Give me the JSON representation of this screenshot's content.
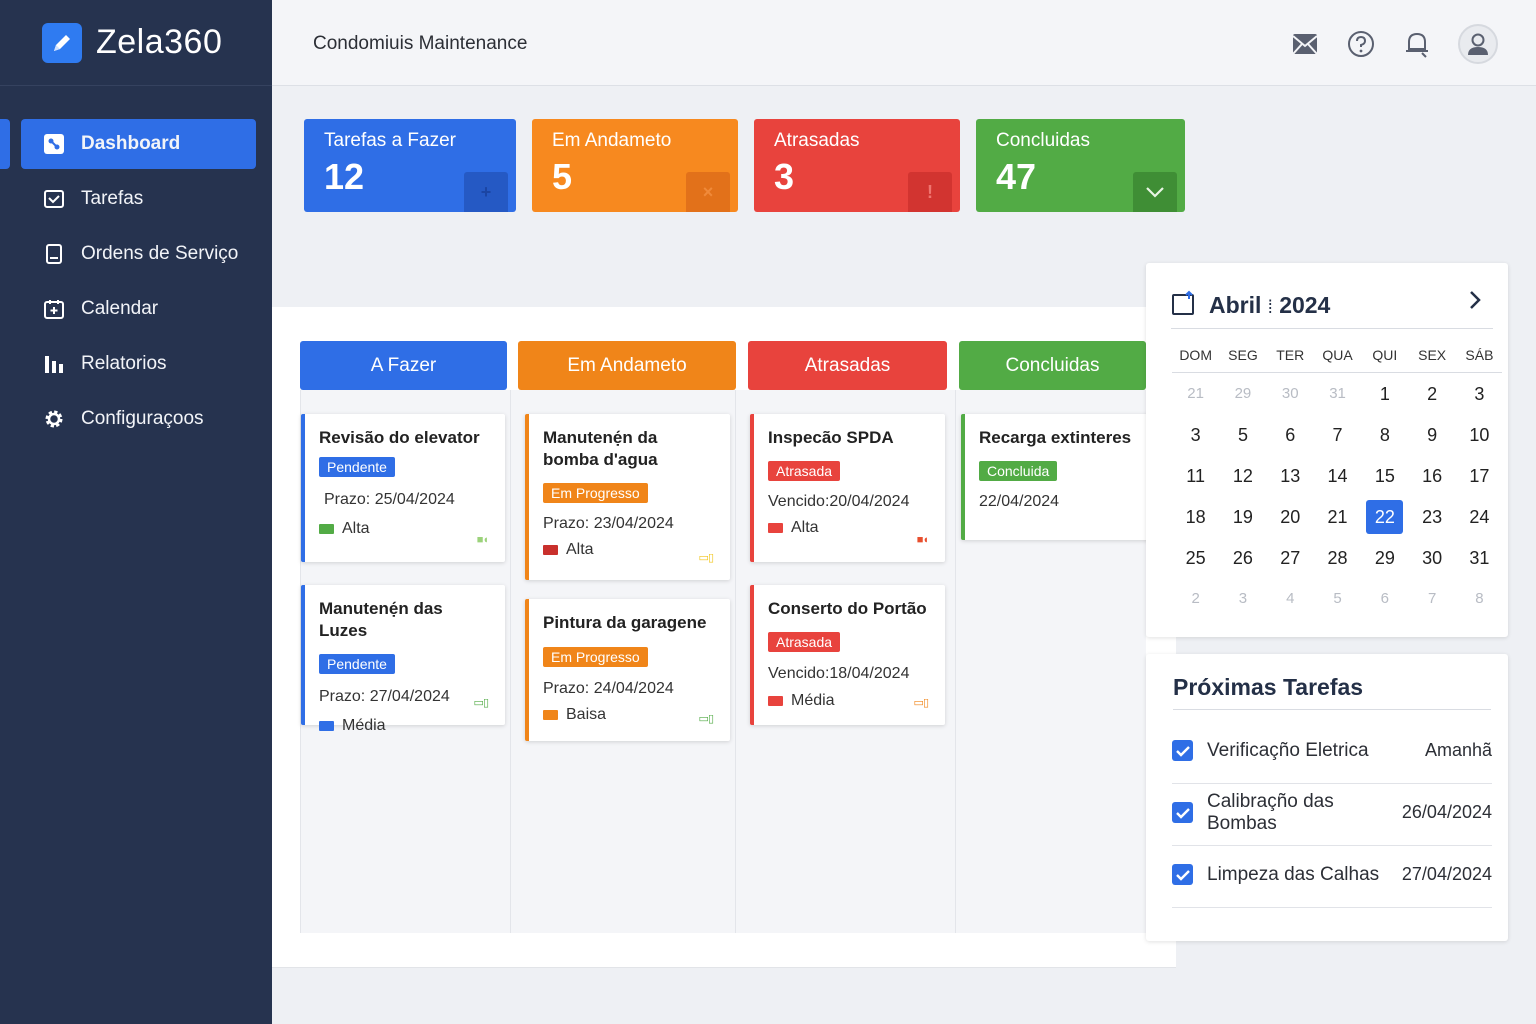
{
  "app": {
    "name": "Zela360",
    "title": "Condomiuis Maintenance"
  },
  "sidebar": {
    "items": [
      {
        "label": "Dashboard",
        "icon": "dashboard-icon",
        "active": true
      },
      {
        "label": "Tarefas",
        "icon": "tasks-icon"
      },
      {
        "label": "Ordens de Serviço",
        "icon": "orders-icon"
      },
      {
        "label": "Calendar",
        "icon": "calendar-icon"
      },
      {
        "label": "Relatorios",
        "icon": "reports-icon"
      },
      {
        "label": "Configuraçoos",
        "icon": "settings-icon"
      }
    ]
  },
  "topbar": {
    "icons": [
      "mail-icon",
      "help-icon",
      "notification-icon",
      "user-avatar"
    ]
  },
  "stats": [
    {
      "label": "Tarefas a Fazer",
      "value": "12",
      "color": "#2f6ee6",
      "icon_color": "#2559c4",
      "icon": "plus-icon"
    },
    {
      "label": "Em Andameto",
      "value": "5",
      "color": "#f7891f",
      "icon_color": "#e2711a",
      "icon": "close-icon"
    },
    {
      "label": "Atrasadas",
      "value": "3",
      "color": "#e8433d",
      "icon_color": "#d23430",
      "icon": "alert-icon"
    },
    {
      "label": "Concluidas",
      "value": "47",
      "color": "#52ab45",
      "icon_color": "#3f8e35",
      "icon": "check-icon"
    }
  ],
  "board": {
    "columns": [
      {
        "title": "A Fazer",
        "color": "#2f6ee6"
      },
      {
        "title": "Em Andameto",
        "color": "#f08519"
      },
      {
        "title": "Atrasadas",
        "color": "#e8433d"
      },
      {
        "title": "Concluidas",
        "color": "#52ab45"
      }
    ],
    "cards": {
      "c1": {
        "title": "Revisão do elevator",
        "badge": "Pendente",
        "line": "Prazo: 25/04/2024",
        "priority": "Alta"
      },
      "c2": {
        "title": "Manutenẹ́n das Luzes",
        "badge": "Pendente",
        "line": "Prazo: 27/04/2024",
        "priority": "Média"
      },
      "c3": {
        "title": "Manutenẹ́n da bomba d'agua",
        "badge": "Em Progresso",
        "line": "Prazo: 23/04/2024",
        "priority": "Alta"
      },
      "c4": {
        "title": "Pintura da garagene",
        "badge": "Em Progresso",
        "line": "Prazo: 24/04/2024",
        "priority": "Baisa"
      },
      "c5": {
        "title": "Inspecão SPDA",
        "badge": "Atrasada",
        "line": "Vencido:20/04/2024",
        "priority": "Alta"
      },
      "c6": {
        "title": "Conserto do Portão",
        "badge": "Atrasada",
        "line": "Vencido:18/04/2024",
        "priority": "Média"
      },
      "c7": {
        "title": "Recarga extinteres",
        "badge": "Concluida",
        "line": "22/04/2024"
      }
    }
  },
  "calendar": {
    "month": "Abril",
    "sep": "⁞",
    "year": "2024",
    "weekdays": [
      "DOM",
      "SEG",
      "TER",
      "QUA",
      "QUI",
      "SEX",
      "SÁB"
    ],
    "weeks": [
      [
        "21",
        "29",
        "30",
        "31",
        "1",
        "2",
        "3"
      ],
      [
        "3",
        "5",
        "6",
        "7",
        "8",
        "9",
        "10"
      ],
      [
        "11",
        "12",
        "13",
        "14",
        "15",
        "16",
        "17"
      ],
      [
        "18",
        "19",
        "20",
        "21",
        "22",
        "23",
        "24"
      ],
      [
        "25",
        "26",
        "27",
        "28",
        "29",
        "30",
        "31"
      ],
      [
        "2",
        "3",
        "4",
        "5",
        "6",
        "7",
        "8"
      ]
    ],
    "today": "22"
  },
  "upcoming": {
    "title": "Próximas Tarefas",
    "items": [
      {
        "name": "Verificaçño Eletrica",
        "date": "Amanhã"
      },
      {
        "name": "Calibraçño das Bombas",
        "date": "26/04/2024"
      },
      {
        "name": "Limpeza das Calhas",
        "date": "27/04/2024"
      }
    ]
  }
}
